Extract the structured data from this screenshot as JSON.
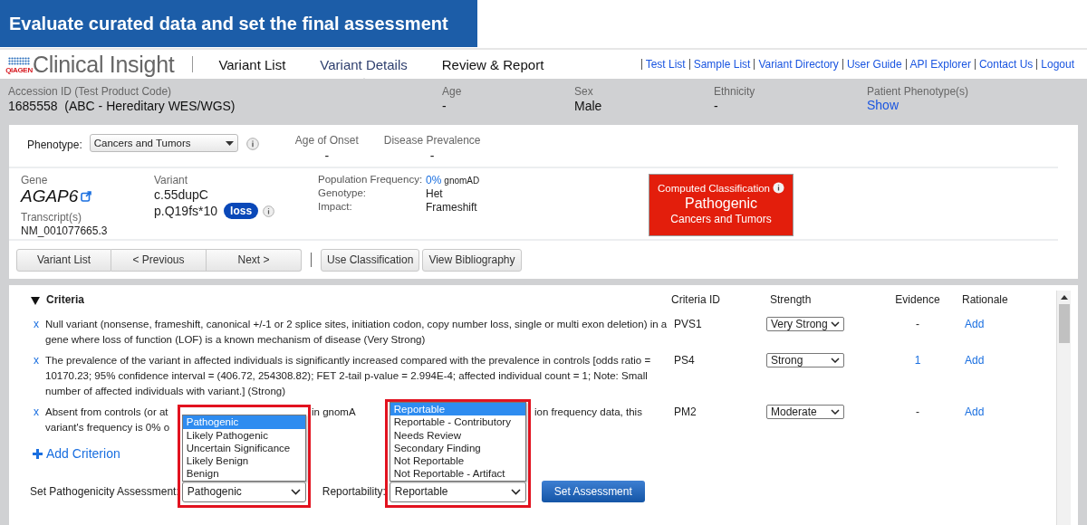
{
  "banner": {
    "title": "Evaluate curated data and set the final assessment"
  },
  "header": {
    "logo_text": "QIAGEN",
    "app_name": "Clinical Insight",
    "tabs": [
      {
        "label": "Variant List",
        "selected": false
      },
      {
        "label": "Variant Details",
        "selected": true
      },
      {
        "label": "Review & Report",
        "selected": false
      }
    ],
    "links": [
      "Test List",
      "Sample List",
      "Variant Directory",
      "User Guide",
      "API Explorer",
      "Contact Us",
      "Logout"
    ]
  },
  "patient": [
    {
      "label": "Accession ID (Test Product Code)",
      "value": "1685558  (ABC - Hereditary WES/WGS)",
      "kind": "text"
    },
    {
      "label": "Age",
      "value": "-",
      "kind": "text"
    },
    {
      "label": "Sex",
      "value": "Male",
      "kind": "text"
    },
    {
      "label": "Ethnicity",
      "value": "-",
      "kind": "text"
    },
    {
      "label": "Patient Phenotype(s)",
      "value": "Show",
      "kind": "link"
    }
  ],
  "phenotype": {
    "label": "Phenotype:",
    "value": "Cancers and Tumors"
  },
  "stats": [
    {
      "label": "Age of Onset",
      "value": "-"
    },
    {
      "label": "Disease Prevalence",
      "value": "-"
    }
  ],
  "gene": {
    "label": "Gene",
    "name": "AGAP6",
    "transcript_label": "Transcript(s)",
    "transcript": "NM_001077665.3"
  },
  "variant": {
    "label": "Variant",
    "cdna": "c.55dupC",
    "protein": "p.Q19fs*10",
    "badge": "loss"
  },
  "properties": [
    {
      "label": "Population Frequency:",
      "value": "0%",
      "source": "gnomAD",
      "kind": "link"
    },
    {
      "label": "Genotype:",
      "value": "Het",
      "kind": "text"
    },
    {
      "label": "Impact:",
      "value": "Frameshift",
      "kind": "text"
    }
  ],
  "classification": {
    "title": "Computed Classification",
    "value": "Pathogenic",
    "phenotype": "Cancers and Tumors"
  },
  "nav_buttons": [
    "Variant List",
    "< Previous",
    "Next >"
  ],
  "action_buttons": [
    "Use Classification",
    "View Bibliography"
  ],
  "criteria": {
    "title": "Criteria",
    "expanded": true,
    "columns": [
      "Criteria ID",
      "Strength",
      "Evidence",
      "Rationale"
    ],
    "rows": [
      {
        "remove": "x",
        "description_lines": [
          [
            "Null variant (nonsense, frameshift, canonical +/-1 or 2 splice sites, initiation codon, copy number loss, single or multi exon deletion) in a gene where loss of function (LOF) is a known mechanism of disease (Very Strong)"
          ]
        ],
        "id": "PVS1",
        "strength": "Very Strong",
        "evidence": "-",
        "evidence_link": false,
        "rationale": "Add"
      },
      {
        "remove": "x",
        "description_lines": [
          [
            "The prevalence of the variant in affected individuals is significantly increased compared with the prevalence in controls [odds ratio = 10170.23; 95% confidence interval = (406.72, 254308.82); FET 2-tail p-value = 2.994E-4; affected individual count = 1; Note: Small number of affected individuals with variant.] (Strong)"
          ]
        ],
        "id": "PS4",
        "strength": "Strong",
        "evidence": "1",
        "evidence_link": true,
        "rationale": "Add"
      },
      {
        "remove": "x",
        "description_lines": [
          [
            "Absent from controls (or at",
            "in gnomA",
            "ion frequency data, this"
          ],
          [
            "variant's frequency is 0% o"
          ]
        ],
        "id": "PM2",
        "strength": "Moderate",
        "evidence": "-",
        "evidence_link": false,
        "rationale": "Add"
      }
    ],
    "add_label": "Add Criterion"
  },
  "assessment": {
    "label": "Set Pathogenicity Assessment:",
    "value": "Pathogenic",
    "open": true,
    "highlighted": true,
    "options": [
      {
        "label": "Pathogenic",
        "selected": true
      },
      {
        "label": "Likely Pathogenic",
        "selected": false
      },
      {
        "label": "Uncertain Significance",
        "selected": false
      },
      {
        "label": "Likely Benign",
        "selected": false
      },
      {
        "label": "Benign",
        "selected": false
      }
    ]
  },
  "reportability": {
    "label": "Reportability:",
    "value": "Reportable",
    "open": true,
    "highlighted": true,
    "options": [
      {
        "label": "Reportable",
        "selected": true
      },
      {
        "label": "Reportable - Contributory",
        "selected": false
      },
      {
        "label": "Needs Review",
        "selected": false
      },
      {
        "label": "Secondary Finding",
        "selected": false
      },
      {
        "label": "Not Reportable",
        "selected": false
      },
      {
        "label": "Not Reportable - Artifact",
        "selected": false
      }
    ]
  },
  "submit": "Set Assessment"
}
